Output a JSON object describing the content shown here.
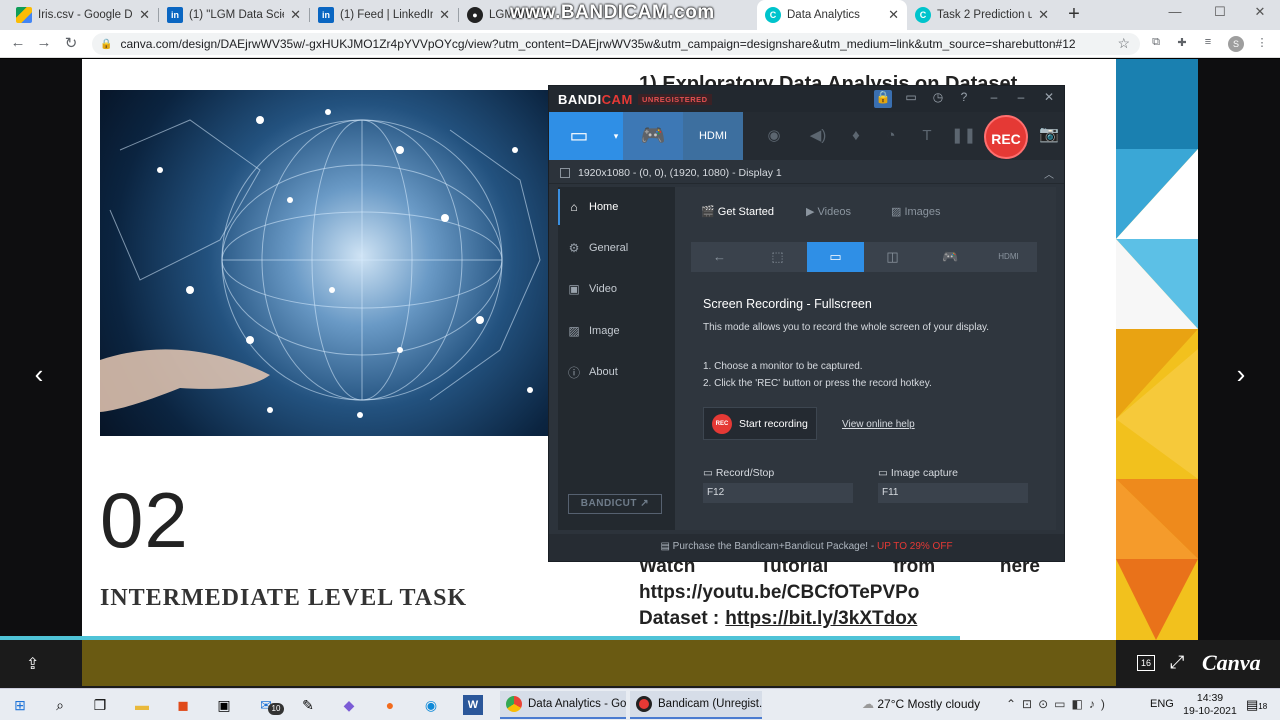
{
  "browser": {
    "tabs": [
      {
        "label": "Iris.csv - Google Drive",
        "icon": "google-drive-icon"
      },
      {
        "label": "(1) \"LGM Data Scienc",
        "icon": "linkedin-icon"
      },
      {
        "label": "(1) Feed | LinkedIn",
        "icon": "linkedin-icon"
      },
      {
        "label": "LGMVIP/Let",
        "icon": "github-icon"
      },
      {
        "label": "Data Analytics",
        "icon": "canva-icon"
      },
      {
        "label": "Task 2 Prediction usin",
        "icon": "canva-icon"
      }
    ],
    "url": "canva.com/design/DAEjrwWV35w/-gxHUKJMO1Zr4pYVVpOYcg/view?utm_content=DAEjrwWV35w&utm_campaign=designshare&utm_medium=link&utm_source=sharebutton#12",
    "avatar_initial": "S"
  },
  "watermark": "www.BANDICAM.com",
  "slide": {
    "right_heading": "1) Exploratory Data Analysis on Dataset",
    "number": "02",
    "level_title": "INTERMEDIATE LEVEL TASK",
    "watch_words": [
      "Watch",
      "Tutorial",
      "from",
      "here"
    ],
    "youtube_url": "https://youtu.be/CBCfOTePVPo",
    "dataset_label": "Dataset :",
    "dataset_url": "https://bit.ly/3kXTdox"
  },
  "canva": {
    "page_count": "16",
    "logo": "Canva",
    "progress": 0.75
  },
  "bandicam": {
    "logo": "BANDICAM",
    "unregistered": "UNREGISTERED",
    "rec_label": "REC",
    "display_text": "1920x1080 - (0, 0), (1920, 1080) - Display 1",
    "sidebar": [
      "Home",
      "General",
      "Video",
      "Image",
      "About"
    ],
    "bandicut": "BANDICUT",
    "subtabs": [
      "Get Started",
      "Videos",
      "Images"
    ],
    "heading": "Screen Recording - Fullscreen",
    "description": "This mode allows you to record the whole screen of your display.",
    "step1": "1. Choose a monitor to be captured.",
    "step2": "2. Click the 'REC' button or press the record hotkey.",
    "start_button": "Start recording",
    "start_icon": "REC",
    "online_help": "View online help",
    "record_stop_label": "Record/Stop",
    "record_stop_key": "F12",
    "image_capture_label": "Image capture",
    "image_capture_key": "F11",
    "footer_text": "Purchase the Bandicam+Bandicut Package! -",
    "footer_offer": "UP TO 29% OFF"
  },
  "taskbar": {
    "mail_badge": "10",
    "items": [
      {
        "label": "Data Analytics - Go..."
      },
      {
        "label": "Bandicam (Unregist..."
      }
    ],
    "weather": "27°C  Mostly cloudy",
    "language": "ENG",
    "time": "14:39",
    "date": "19-10-2021",
    "notifications": "18"
  }
}
